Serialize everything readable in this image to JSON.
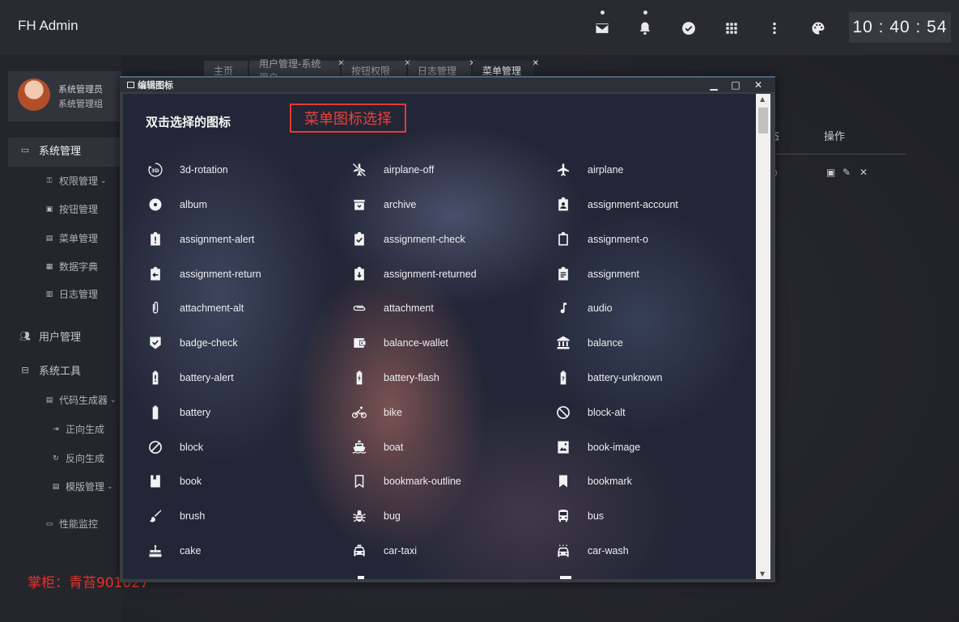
{
  "app": {
    "title": "FH Admin"
  },
  "clock": "10 : 40 : 54",
  "topbar": {
    "icons": [
      "mail-icon",
      "bell-icon",
      "check-circle-icon",
      "apps-grid-icon",
      "more-vertical-icon",
      "palette-icon"
    ]
  },
  "user": {
    "name": "系统管理员",
    "role": "系统管理组"
  },
  "sidebar": {
    "items": [
      {
        "label": "系统管理"
      },
      {
        "label": "权限管理"
      },
      {
        "label": "按钮管理"
      },
      {
        "label": "菜单管理"
      },
      {
        "label": "数据字典"
      },
      {
        "label": "日志管理"
      },
      {
        "label": "用户管理"
      },
      {
        "label": "系统工具"
      },
      {
        "label": "代码生成器"
      },
      {
        "label": "正向生成"
      },
      {
        "label": "反向生成"
      },
      {
        "label": "模版管理"
      },
      {
        "label": "性能监控"
      }
    ]
  },
  "tabs": [
    {
      "label": "主页"
    },
    {
      "label": "用户管理-系统用户"
    },
    {
      "label": "按钮权限"
    },
    {
      "label": "日志管理"
    },
    {
      "label": "菜单管理"
    }
  ],
  "background_table": {
    "col_status": "态",
    "col_actions": "操作"
  },
  "modal": {
    "title": "编辑图标",
    "heading": "双击选择的图标",
    "annotation": "菜单图标选择",
    "icons": [
      {
        "label": "3d-rotation",
        "icon": "3d-rotation-icon"
      },
      {
        "label": "airplane-off",
        "icon": "airplane-off-icon"
      },
      {
        "label": "airplane",
        "icon": "airplane-icon"
      },
      {
        "label": "album",
        "icon": "album-icon"
      },
      {
        "label": "archive",
        "icon": "archive-icon"
      },
      {
        "label": "assignment-account",
        "icon": "assignment-account-icon"
      },
      {
        "label": "assignment-alert",
        "icon": "assignment-alert-icon"
      },
      {
        "label": "assignment-check",
        "icon": "assignment-check-icon"
      },
      {
        "label": "assignment-o",
        "icon": "assignment-o-icon"
      },
      {
        "label": "assignment-return",
        "icon": "assignment-return-icon"
      },
      {
        "label": "assignment-returned",
        "icon": "assignment-returned-icon"
      },
      {
        "label": "assignment",
        "icon": "assignment-icon"
      },
      {
        "label": "attachment-alt",
        "icon": "attachment-alt-icon"
      },
      {
        "label": "attachment",
        "icon": "attachment-icon"
      },
      {
        "label": "audio",
        "icon": "audio-icon"
      },
      {
        "label": "badge-check",
        "icon": "badge-check-icon"
      },
      {
        "label": "balance-wallet",
        "icon": "balance-wallet-icon"
      },
      {
        "label": "balance",
        "icon": "balance-icon"
      },
      {
        "label": "battery-alert",
        "icon": "battery-alert-icon"
      },
      {
        "label": "battery-flash",
        "icon": "battery-flash-icon"
      },
      {
        "label": "battery-unknown",
        "icon": "battery-unknown-icon"
      },
      {
        "label": "battery",
        "icon": "battery-icon"
      },
      {
        "label": "bike",
        "icon": "bike-icon"
      },
      {
        "label": "block-alt",
        "icon": "block-alt-icon"
      },
      {
        "label": "block",
        "icon": "block-icon"
      },
      {
        "label": "boat",
        "icon": "boat-icon"
      },
      {
        "label": "book-image",
        "icon": "book-image-icon"
      },
      {
        "label": "book",
        "icon": "book-icon"
      },
      {
        "label": "bookmark-outline",
        "icon": "bookmark-outline-icon"
      },
      {
        "label": "bookmark",
        "icon": "bookmark-icon"
      },
      {
        "label": "brush",
        "icon": "brush-icon"
      },
      {
        "label": "bug",
        "icon": "bug-icon"
      },
      {
        "label": "bus",
        "icon": "bus-icon"
      },
      {
        "label": "cake",
        "icon": "cake-icon"
      },
      {
        "label": "car-taxi",
        "icon": "car-taxi-icon"
      },
      {
        "label": "car-wash",
        "icon": "car-wash-icon"
      }
    ]
  },
  "watermark": "掌柜：青苔901027"
}
